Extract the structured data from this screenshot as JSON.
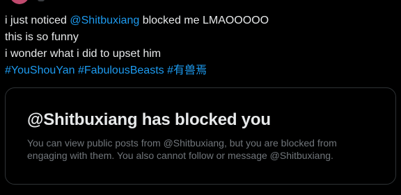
{
  "tweet": {
    "line1_prefix": "i just noticed ",
    "line1_mention": "@Shitbuxiang",
    "line1_suffix": " blocked me LMAOOOOO",
    "line2": "this is so funny",
    "line3": "i wonder what i did to upset him",
    "hashtags": [
      "#YouShouYan",
      "#FabulousBeasts",
      "#有兽焉"
    ]
  },
  "blocked_card": {
    "title": "@Shitbuxiang has blocked you",
    "body": "You can view public posts from @Shitbuxiang, but you are blocked from engaging with them. You also cannot follow or message @Shitbuxiang."
  },
  "colors": {
    "background": "#000000",
    "text": "#e7e9ea",
    "link": "#1d9bf0",
    "muted": "#71767b",
    "border": "#2f3336"
  }
}
